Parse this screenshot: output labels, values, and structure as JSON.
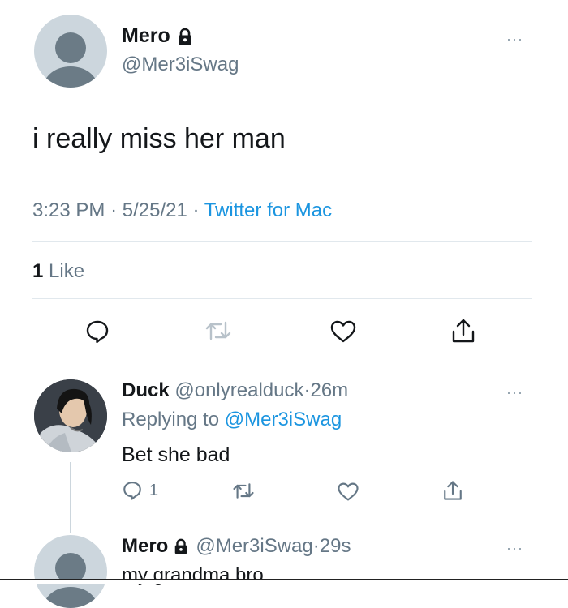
{
  "main_tweet": {
    "display_name": "Mero",
    "handle": "@Mer3iSwag",
    "text": "i really miss her man",
    "time": "3:23 PM",
    "date": "5/25/21",
    "source": "Twitter for Mac",
    "sep1": "·",
    "sep2": "·",
    "like_count": "1",
    "like_label": "Like"
  },
  "reply1": {
    "display_name": "Duck",
    "handle": "@onlyrealduck",
    "sep": "·",
    "age": "26m",
    "replying_prefix": "Replying to",
    "replying_to": "@Mer3iSwag",
    "text": "Bet she bad",
    "reply_count": "1"
  },
  "reply2": {
    "display_name": "Mero",
    "handle": "@Mer3iSwag",
    "sep": "·",
    "age": "29s",
    "text": "my grandma bro"
  },
  "more_glyph": "···",
  "colors": {
    "link": "#1b95e0",
    "muted": "#657786",
    "divider": "#e1e8ed"
  }
}
